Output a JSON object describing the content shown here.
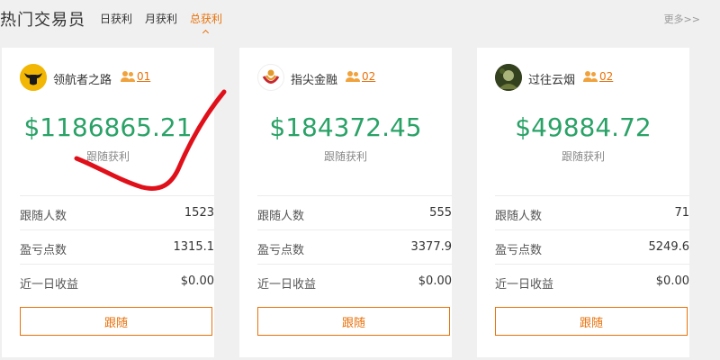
{
  "header": {
    "title": "热门交易员",
    "tabs": [
      {
        "label": "日获利",
        "active": false
      },
      {
        "label": "月获利",
        "active": false
      },
      {
        "label": "总获利",
        "active": true
      }
    ],
    "more_label": "更多>>"
  },
  "cards": [
    {
      "name": "领航者之路",
      "follower_badge": "01",
      "profit": "$1186865.21",
      "profit_label": "跟随获利",
      "stats": [
        {
          "label": "跟随人数",
          "value": "1523"
        },
        {
          "label": "盈亏点数",
          "value": "1315.1"
        },
        {
          "label": "近一日收益",
          "value": "$0.00"
        }
      ],
      "button_label": "跟随"
    },
    {
      "name": "指尖金融",
      "follower_badge": "02",
      "profit": "$184372.45",
      "profit_label": "跟随获利",
      "stats": [
        {
          "label": "跟随人数",
          "value": "555"
        },
        {
          "label": "盈亏点数",
          "value": "3377.9"
        },
        {
          "label": "近一日收益",
          "value": "$0.00"
        }
      ],
      "button_label": "跟随"
    },
    {
      "name": "过往云烟",
      "follower_badge": "02",
      "profit": "$49884.72",
      "profit_label": "跟随获利",
      "stats": [
        {
          "label": "跟随人数",
          "value": "71"
        },
        {
          "label": "盈亏点数",
          "value": "5249.6"
        },
        {
          "label": "近一日收益",
          "value": "$0.00"
        }
      ],
      "button_label": "跟随"
    }
  ],
  "colors": {
    "accent": "#e8720c",
    "profit_green": "#2aa267",
    "scribble_red": "#e0101a"
  },
  "icons": {
    "group": "users-icon",
    "avatar_1": "bull-logo-avatar",
    "avatar_2": "swirl-logo-avatar",
    "avatar_3": "photo-avatar"
  }
}
